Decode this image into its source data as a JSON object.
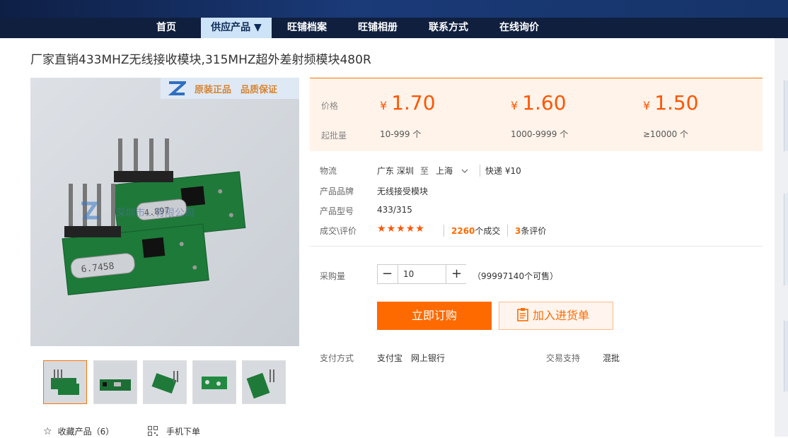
{
  "nav": {
    "items": [
      "首页",
      "供应产品 ▼",
      "旺铺档案",
      "旺铺相册",
      "联系方式",
      "在线询价"
    ],
    "active_index": 1
  },
  "product": {
    "title": "厂家直销433MHZ无线接收模块,315MHZ超外差射频模块480R",
    "badge_text": "原装正品　品质保证",
    "image_overlay_text": "深圳市…有限公司"
  },
  "price": {
    "price_label": "价格",
    "moq_label": "起批量",
    "currency": "¥",
    "tiers": [
      {
        "price": "1.70",
        "range": "10-999 个"
      },
      {
        "price": "1.60",
        "range": "1000-9999 个"
      },
      {
        "price": "1.50",
        "range": "≥10000 个"
      }
    ]
  },
  "info": {
    "logistics_label": "物流",
    "from": "广东 深圳",
    "to_word": "至",
    "to": "上海",
    "shipping": "快递 ¥10",
    "brand_label": "产品品牌",
    "brand": "无线接受模块",
    "model_label": "产品型号",
    "model": "433/315",
    "deals_label": "成交\\评价",
    "rating_stars": 5,
    "deal_count": "2260",
    "deal_suffix": "个成交",
    "review_count": "3",
    "review_suffix": "条评价"
  },
  "order": {
    "qty_label": "采购量",
    "quantity": "10",
    "minus": "−",
    "plus": "+",
    "stock_text": "（99997140个可售）",
    "buy_label": "立即订购",
    "cart_label": "加入进货单"
  },
  "payment": {
    "label": "支付方式",
    "methods": "支付宝　网上银行",
    "trade_label": "交易支持",
    "trade_value": "混批"
  },
  "bottom": {
    "favorite_label": "收藏产品（6）",
    "mobile_label": "手机下单"
  },
  "colors": {
    "accent": "#ff6a00",
    "nav_bg": "#101f3e",
    "nav_active": "#cde3f7"
  }
}
